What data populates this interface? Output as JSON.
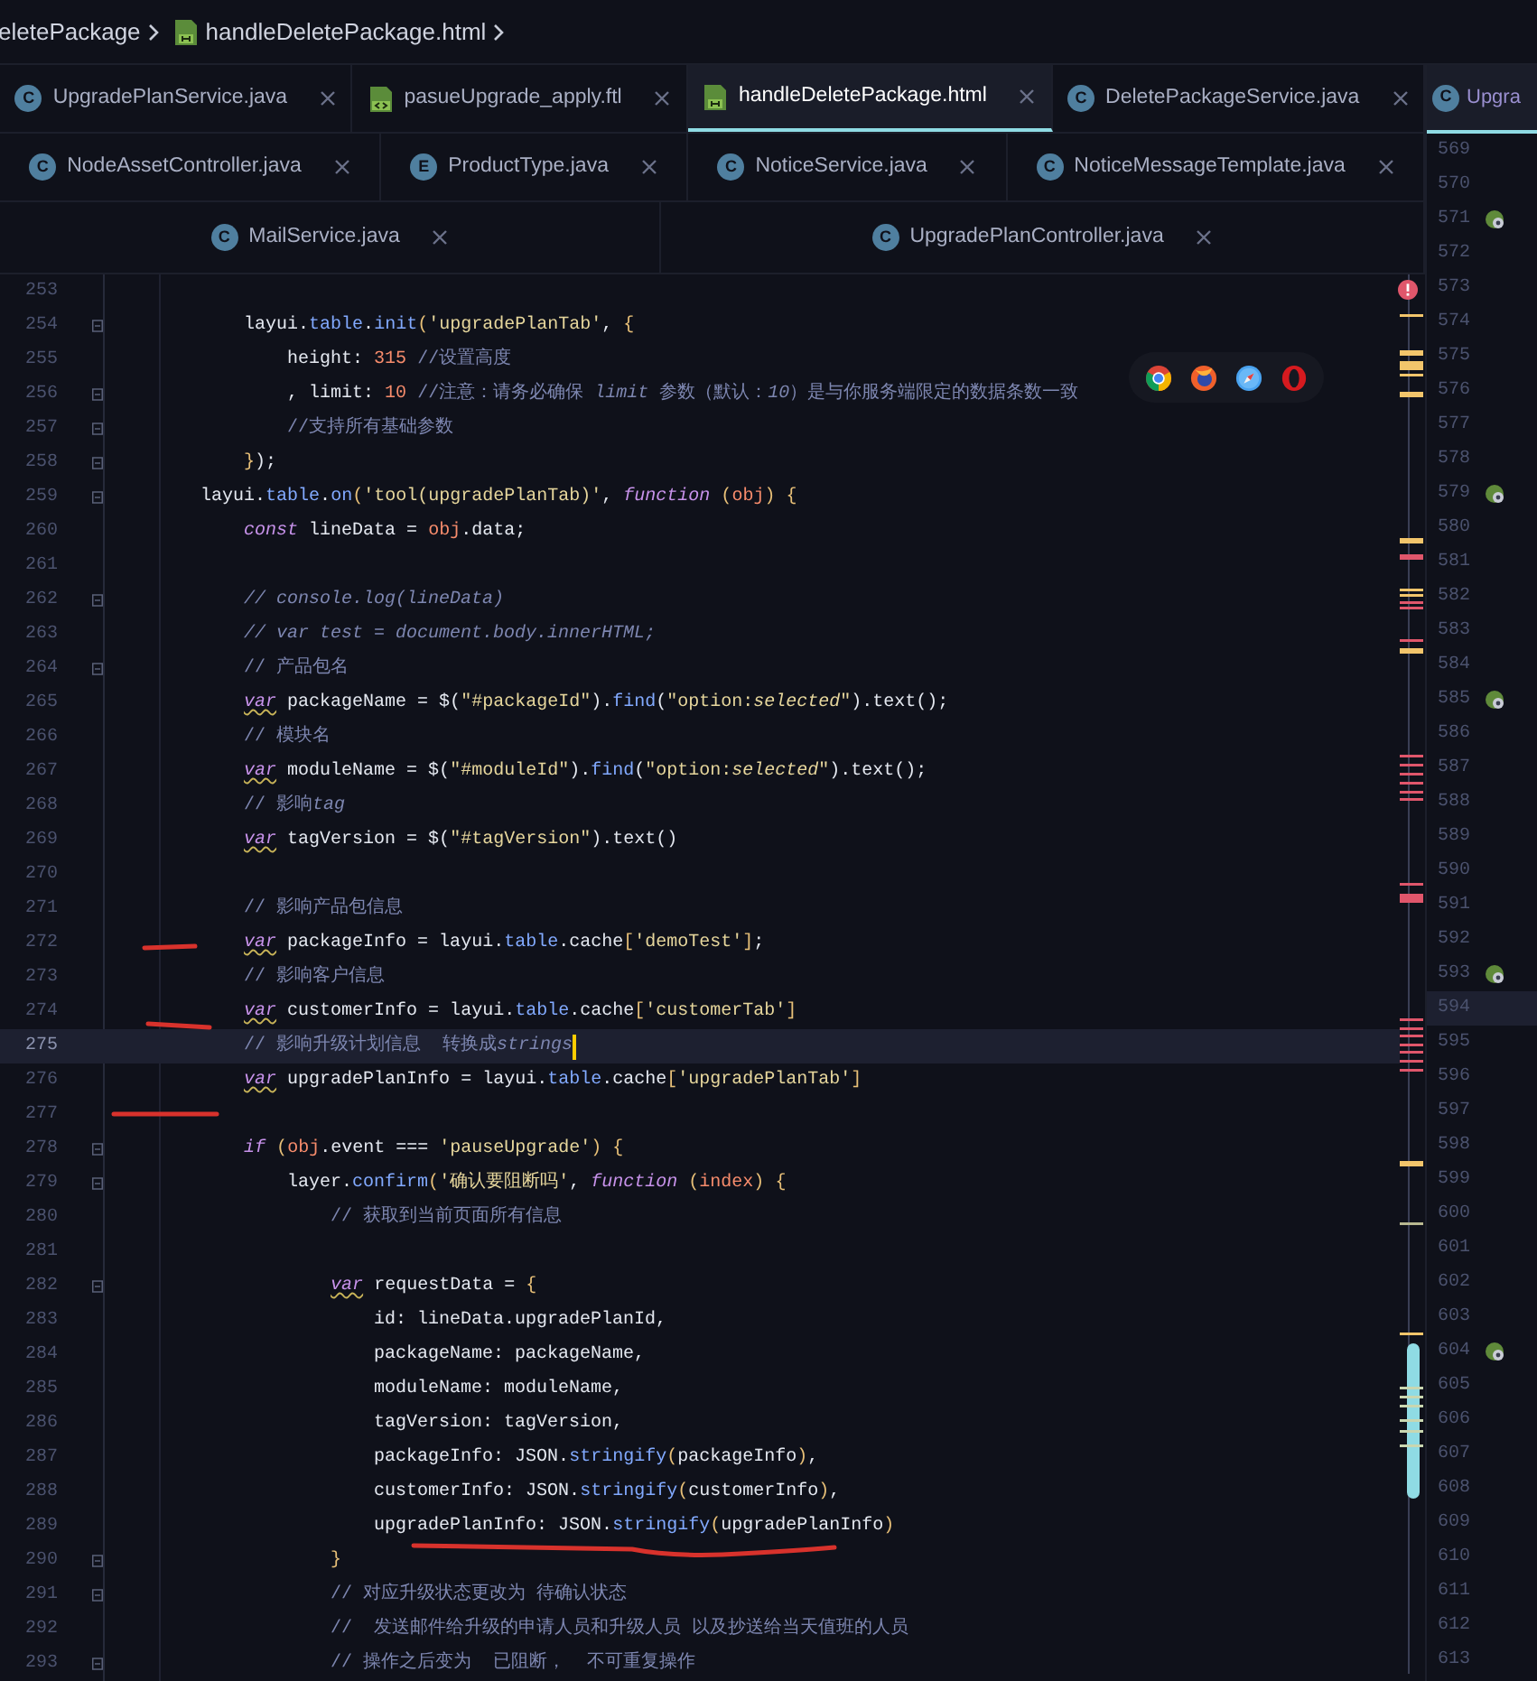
{
  "breadcrumb": [
    {
      "label": "eletePackage",
      "kind": "text"
    },
    {
      "label": "handleDeletePackage.html",
      "kind": "file"
    }
  ],
  "tab_rows": [
    [
      {
        "label": "UpgradePlanService.java",
        "icon": {
          "kind": "letter",
          "text": "C"
        },
        "selected": false
      },
      {
        "label": "pasueUpgrade_apply.ftl",
        "icon": {
          "kind": "ftl"
        },
        "selected": false
      },
      {
        "label": "handleDeletePackage.html",
        "icon": {
          "kind": "html"
        },
        "selected": true
      },
      {
        "label": "DeletePackageService.java",
        "icon": {
          "kind": "letter",
          "text": "C"
        },
        "selected": false
      }
    ],
    [
      {
        "label": "NodeAssetController.java",
        "icon": {
          "kind": "letter",
          "text": "C"
        },
        "selected": false
      },
      {
        "label": "ProductType.java",
        "icon": {
          "kind": "letter",
          "text": "E"
        },
        "selected": false
      },
      {
        "label": "NoticeService.java",
        "icon": {
          "kind": "letter",
          "text": "C"
        },
        "selected": false
      },
      {
        "label": "NoticeMessageTemplate.java",
        "icon": {
          "kind": "letter",
          "text": "C"
        },
        "selected": false
      }
    ],
    [
      {
        "label": "MailService.java",
        "icon": {
          "kind": "letter",
          "text": "C"
        },
        "selected": false
      },
      {
        "label": "UpgradePlanController.java",
        "icon": {
          "kind": "letter",
          "text": "C"
        },
        "selected": false
      }
    ]
  ],
  "code_lines": [
    {
      "number": "253",
      "fold": false,
      "current": false
    },
    {
      "number": "254",
      "fold": true,
      "current": false,
      "tokens": [
        {
          "kind": "plain",
          "text": "            layui."
        },
        {
          "kind": "member",
          "text": "table"
        },
        {
          "kind": "plain",
          "text": "."
        },
        {
          "kind": "member",
          "text": "init"
        },
        {
          "kind": "bracket",
          "text": "("
        },
        {
          "kind": "string",
          "text": "'upgradePlanTab'"
        },
        {
          "kind": "plain",
          "text": ", "
        },
        {
          "kind": "bracket",
          "text": "{"
        }
      ]
    },
    {
      "number": "255",
      "fold": false,
      "current": false,
      "tokens": [
        {
          "kind": "plain",
          "text": "                height: "
        },
        {
          "kind": "number",
          "text": "315"
        },
        {
          "kind": "comment",
          "text": " //设置高度"
        }
      ]
    },
    {
      "number": "256",
      "fold": true,
      "current": false,
      "tokens": [
        {
          "kind": "plain",
          "text": "                , limit: "
        },
        {
          "kind": "number",
          "text": "10"
        },
        {
          "kind": "comment",
          "text": " //注意：请务必确保 "
        },
        {
          "kind": "note",
          "text": "limit"
        },
        {
          "kind": "comment",
          "text": " 参数（默认："
        },
        {
          "kind": "note",
          "text": "10"
        },
        {
          "kind": "comment",
          "text": "）是与你服务端限定的数据条数一致"
        }
      ]
    },
    {
      "number": "257",
      "fold": true,
      "current": false,
      "tokens": [
        {
          "kind": "comment",
          "text": "                //支持所有基础参数"
        }
      ]
    },
    {
      "number": "258",
      "fold": true,
      "current": false,
      "tokens": [
        {
          "kind": "bracket",
          "text": "            }"
        },
        {
          "kind": "plain",
          "text": ");"
        }
      ]
    },
    {
      "number": "259",
      "fold": true,
      "current": false,
      "tokens": [
        {
          "kind": "plain",
          "text": "        layui."
        },
        {
          "kind": "member",
          "text": "table"
        },
        {
          "kind": "plain",
          "text": "."
        },
        {
          "kind": "member",
          "text": "on"
        },
        {
          "kind": "bracket",
          "text": "("
        },
        {
          "kind": "string",
          "text": "'tool(upgradePlanTab)'"
        },
        {
          "kind": "plain",
          "text": ", "
        },
        {
          "kind": "keyword",
          "text": "function"
        },
        {
          "kind": "bracket",
          "text": " ("
        },
        {
          "kind": "param",
          "text": "obj"
        },
        {
          "kind": "bracket",
          "text": ")"
        },
        {
          "kind": "bracket",
          "text": " {"
        }
      ]
    },
    {
      "number": "260",
      "fold": false,
      "current": false,
      "tokens": [
        {
          "kind": "keyword",
          "text": "            const"
        },
        {
          "kind": "plain",
          "text": " lineData = "
        },
        {
          "kind": "param",
          "text": "obj"
        },
        {
          "kind": "plain",
          "text": ".data;"
        }
      ]
    },
    {
      "number": "261",
      "fold": false,
      "current": false
    },
    {
      "number": "262",
      "fold": true,
      "current": false,
      "tokens": [
        {
          "kind": "note",
          "text": "            // console.log(lineData)"
        }
      ]
    },
    {
      "number": "263",
      "fold": false,
      "current": false,
      "tokens": [
        {
          "kind": "note",
          "text": "            // var test = document.body.innerHTML;"
        }
      ]
    },
    {
      "number": "264",
      "fold": true,
      "current": false,
      "tokens": [
        {
          "kind": "comment",
          "text": "            // 产品包名"
        }
      ]
    },
    {
      "number": "265",
      "fold": false,
      "current": false,
      "tokens": [
        {
          "kind": "flagged",
          "text": "            var"
        },
        {
          "kind": "plain",
          "text": " packageName = $("
        },
        {
          "kind": "string",
          "text": "\"#packageId\""
        },
        {
          "kind": "plain",
          "text": ")."
        },
        {
          "kind": "member",
          "text": "find"
        },
        {
          "kind": "plain",
          "text": "("
        },
        {
          "kind": "string",
          "text": "\"option:"
        },
        {
          "kind": "emphasis",
          "text": "selected"
        },
        {
          "kind": "string",
          "text": "\""
        },
        {
          "kind": "plain",
          "text": ").text();"
        }
      ]
    },
    {
      "number": "266",
      "fold": false,
      "current": false,
      "tokens": [
        {
          "kind": "comment",
          "text": "            // 模块名"
        }
      ]
    },
    {
      "number": "267",
      "fold": false,
      "current": false,
      "tokens": [
        {
          "kind": "flagged",
          "text": "            var"
        },
        {
          "kind": "plain",
          "text": " moduleName = $("
        },
        {
          "kind": "string",
          "text": "\"#moduleId\""
        },
        {
          "kind": "plain",
          "text": ")."
        },
        {
          "kind": "member",
          "text": "find"
        },
        {
          "kind": "plain",
          "text": "("
        },
        {
          "kind": "string",
          "text": "\"option:"
        },
        {
          "kind": "emphasis",
          "text": "selected"
        },
        {
          "kind": "string",
          "text": "\""
        },
        {
          "kind": "plain",
          "text": ").text();"
        }
      ]
    },
    {
      "number": "268",
      "fold": false,
      "current": false,
      "tokens": [
        {
          "kind": "comment",
          "text": "            // 影响"
        },
        {
          "kind": "note",
          "text": "tag"
        }
      ]
    },
    {
      "number": "269",
      "fold": false,
      "current": false,
      "tokens": [
        {
          "kind": "flagged",
          "text": "            var"
        },
        {
          "kind": "plain",
          "text": " tagVersion = $("
        },
        {
          "kind": "string",
          "text": "\"#tagVersion\""
        },
        {
          "kind": "plain",
          "text": ").text()"
        }
      ]
    },
    {
      "number": "270",
      "fold": false,
      "current": false
    },
    {
      "number": "271",
      "fold": false,
      "current": false,
      "tokens": [
        {
          "kind": "comment",
          "text": "            // 影响产品包信息"
        }
      ]
    },
    {
      "number": "272",
      "fold": false,
      "current": false,
      "tokens": [
        {
          "kind": "flagged",
          "text": "            var"
        },
        {
          "kind": "plain",
          "text": " packageInfo = layui."
        },
        {
          "kind": "member",
          "text": "table"
        },
        {
          "kind": "plain",
          "text": ".cache"
        },
        {
          "kind": "bracket",
          "text": "["
        },
        {
          "kind": "string",
          "text": "'demoTest'"
        },
        {
          "kind": "bracket",
          "text": "]"
        },
        {
          "kind": "plain",
          "text": ";"
        }
      ]
    },
    {
      "number": "273",
      "fold": false,
      "current": false,
      "tokens": [
        {
          "kind": "comment",
          "text": "            // 影响客户信息"
        }
      ]
    },
    {
      "number": "274",
      "fold": false,
      "current": false,
      "tokens": [
        {
          "kind": "flagged",
          "text": "            var"
        },
        {
          "kind": "plain",
          "text": " customerInfo = layui."
        },
        {
          "kind": "member",
          "text": "table"
        },
        {
          "kind": "plain",
          "text": ".cache"
        },
        {
          "kind": "bracket",
          "text": "["
        },
        {
          "kind": "string",
          "text": "'customerTab'"
        },
        {
          "kind": "bracket",
          "text": "]"
        }
      ]
    },
    {
      "number": "275",
      "fold": false,
      "current": true,
      "tokens": [
        {
          "kind": "comment",
          "text": "            // 影响升级计划信息  转换成"
        },
        {
          "kind": "note",
          "text": "strings"
        }
      ]
    },
    {
      "number": "276",
      "fold": false,
      "current": false,
      "tokens": [
        {
          "kind": "flagged",
          "text": "            var"
        },
        {
          "kind": "plain",
          "text": " upgradePlanInfo = layui."
        },
        {
          "kind": "member",
          "text": "table"
        },
        {
          "kind": "plain",
          "text": ".cache"
        },
        {
          "kind": "bracket",
          "text": "["
        },
        {
          "kind": "string",
          "text": "'upgradePlanTab'"
        },
        {
          "kind": "bracket",
          "text": "]"
        }
      ]
    },
    {
      "number": "277",
      "fold": false,
      "current": false
    },
    {
      "number": "278",
      "fold": true,
      "current": false,
      "tokens": [
        {
          "kind": "keyword",
          "text": "            if"
        },
        {
          "kind": "bracket",
          "text": " ("
        },
        {
          "kind": "param",
          "text": "obj"
        },
        {
          "kind": "plain",
          "text": ".event === "
        },
        {
          "kind": "string",
          "text": "'pauseUpgrade'"
        },
        {
          "kind": "bracket",
          "text": ")"
        },
        {
          "kind": "bracket",
          "text": " {"
        }
      ]
    },
    {
      "number": "279",
      "fold": true,
      "current": false,
      "tokens": [
        {
          "kind": "plain",
          "text": "                layer."
        },
        {
          "kind": "member",
          "text": "confirm"
        },
        {
          "kind": "bracket",
          "text": "("
        },
        {
          "kind": "string",
          "text": "'确认要阻断吗'"
        },
        {
          "kind": "plain",
          "text": ", "
        },
        {
          "kind": "keyword",
          "text": "function"
        },
        {
          "kind": "bracket",
          "text": " ("
        },
        {
          "kind": "param",
          "text": "index"
        },
        {
          "kind": "bracket",
          "text": ")"
        },
        {
          "kind": "bracket",
          "text": " {"
        }
      ]
    },
    {
      "number": "280",
      "fold": false,
      "current": false,
      "tokens": [
        {
          "kind": "comment",
          "text": "                    // 获取到当前页面所有信息"
        }
      ]
    },
    {
      "number": "281",
      "fold": false,
      "current": false
    },
    {
      "number": "282",
      "fold": true,
      "current": false,
      "tokens": [
        {
          "kind": "flagged",
          "text": "                    var"
        },
        {
          "kind": "plain",
          "text": " requestData = "
        },
        {
          "kind": "bracket",
          "text": "{"
        }
      ]
    },
    {
      "number": "283",
      "fold": false,
      "current": false,
      "tokens": [
        {
          "kind": "plain",
          "text": "                        id: lineData.upgradePlanId,"
        }
      ]
    },
    {
      "number": "284",
      "fold": false,
      "current": false,
      "tokens": [
        {
          "kind": "plain",
          "text": "                        packageName: packageName,"
        }
      ]
    },
    {
      "number": "285",
      "fold": false,
      "current": false,
      "tokens": [
        {
          "kind": "plain",
          "text": "                        moduleName: moduleName,"
        }
      ]
    },
    {
      "number": "286",
      "fold": false,
      "current": false,
      "tokens": [
        {
          "kind": "plain",
          "text": "                        tagVersion: tagVersion,"
        }
      ]
    },
    {
      "number": "287",
      "fold": false,
      "current": false,
      "tokens": [
        {
          "kind": "plain",
          "text": "                        packageInfo: JSON."
        },
        {
          "kind": "member",
          "text": "stringify"
        },
        {
          "kind": "bracket",
          "text": "("
        },
        {
          "kind": "plain",
          "text": "packageInfo"
        },
        {
          "kind": "bracket",
          "text": ")"
        },
        {
          "kind": "plain",
          "text": ","
        }
      ]
    },
    {
      "number": "288",
      "fold": false,
      "current": false,
      "tokens": [
        {
          "kind": "plain",
          "text": "                        customerInfo: JSON."
        },
        {
          "kind": "member",
          "text": "stringify"
        },
        {
          "kind": "bracket",
          "text": "("
        },
        {
          "kind": "plain",
          "text": "customerInfo"
        },
        {
          "kind": "bracket",
          "text": ")"
        },
        {
          "kind": "plain",
          "text": ","
        }
      ]
    },
    {
      "number": "289",
      "fold": false,
      "current": false,
      "tokens": [
        {
          "kind": "plain",
          "text": "                        upgradePlanInfo: JSON."
        },
        {
          "kind": "member",
          "text": "stringify"
        },
        {
          "kind": "bracket",
          "text": "("
        },
        {
          "kind": "plain",
          "text": "upgradePlanInfo"
        },
        {
          "kind": "bracket",
          "text": ")"
        }
      ]
    },
    {
      "number": "290",
      "fold": true,
      "current": false,
      "tokens": [
        {
          "kind": "bracket",
          "text": "                    }"
        }
      ]
    },
    {
      "number": "291",
      "fold": true,
      "current": false,
      "tokens": [
        {
          "kind": "comment",
          "text": "                    // 对应升级状态更改为 待确认状态"
        }
      ]
    },
    {
      "number": "292",
      "fold": false,
      "current": false,
      "tokens": [
        {
          "kind": "comment",
          "text": "                    //  发送邮件给升级的申请人员和升级人员 以及抄送给当天值班的人员"
        }
      ]
    },
    {
      "number": "293",
      "fold": true,
      "current": false,
      "tokens": [
        {
          "kind": "comment",
          "text": "                    // 操作之后变为  已阻断，  不可重复操作"
        }
      ]
    }
  ],
  "side_pane": {
    "tab": {
      "label": "Upgra",
      "icon": {
        "kind": "letter",
        "text": "C"
      },
      "selected": true
    },
    "lines": [
      {
        "number": "569",
        "marker": false,
        "current": false
      },
      {
        "number": "570",
        "marker": false,
        "current": false
      },
      {
        "number": "571",
        "marker": true,
        "current": false
      },
      {
        "number": "572",
        "marker": false,
        "current": false
      },
      {
        "number": "573",
        "marker": false,
        "current": false
      },
      {
        "number": "574",
        "marker": false,
        "current": false
      },
      {
        "number": "575",
        "marker": false,
        "current": false
      },
      {
        "number": "576",
        "marker": false,
        "current": false
      },
      {
        "number": "577",
        "marker": false,
        "current": false
      },
      {
        "number": "578",
        "marker": false,
        "current": false
      },
      {
        "number": "579",
        "marker": true,
        "current": false
      },
      {
        "number": "580",
        "marker": false,
        "current": false
      },
      {
        "number": "581",
        "marker": false,
        "current": false
      },
      {
        "number": "582",
        "marker": false,
        "current": false
      },
      {
        "number": "583",
        "marker": false,
        "current": false
      },
      {
        "number": "584",
        "marker": false,
        "current": false
      },
      {
        "number": "585",
        "marker": true,
        "current": false
      },
      {
        "number": "586",
        "marker": false,
        "current": false
      },
      {
        "number": "587",
        "marker": false,
        "current": false
      },
      {
        "number": "588",
        "marker": false,
        "current": false
      },
      {
        "number": "589",
        "marker": false,
        "current": false
      },
      {
        "number": "590",
        "marker": false,
        "current": false
      },
      {
        "number": "591",
        "marker": false,
        "current": false
      },
      {
        "number": "592",
        "marker": false,
        "current": false
      },
      {
        "number": "593",
        "marker": true,
        "current": false
      },
      {
        "number": "594",
        "marker": false,
        "current": true
      },
      {
        "number": "595",
        "marker": false,
        "current": false
      },
      {
        "number": "596",
        "marker": false,
        "current": false
      },
      {
        "number": "597",
        "marker": false,
        "current": false
      },
      {
        "number": "598",
        "marker": false,
        "current": false
      },
      {
        "number": "599",
        "marker": false,
        "current": false
      },
      {
        "number": "600",
        "marker": false,
        "current": false
      },
      {
        "number": "601",
        "marker": false,
        "current": false
      },
      {
        "number": "602",
        "marker": false,
        "current": false
      },
      {
        "number": "603",
        "marker": false,
        "current": false
      },
      {
        "number": "604",
        "marker": true,
        "current": false
      },
      {
        "number": "605",
        "marker": false,
        "current": false
      },
      {
        "number": "606",
        "marker": false,
        "current": false
      },
      {
        "number": "607",
        "marker": false,
        "current": false
      },
      {
        "number": "608",
        "marker": false,
        "current": false
      },
      {
        "number": "609",
        "marker": false,
        "current": false
      },
      {
        "number": "610",
        "marker": false,
        "current": false
      },
      {
        "number": "611",
        "marker": false,
        "current": false
      },
      {
        "number": "612",
        "marker": false,
        "current": false
      },
      {
        "number": "613",
        "marker": false,
        "current": false
      }
    ]
  }
}
